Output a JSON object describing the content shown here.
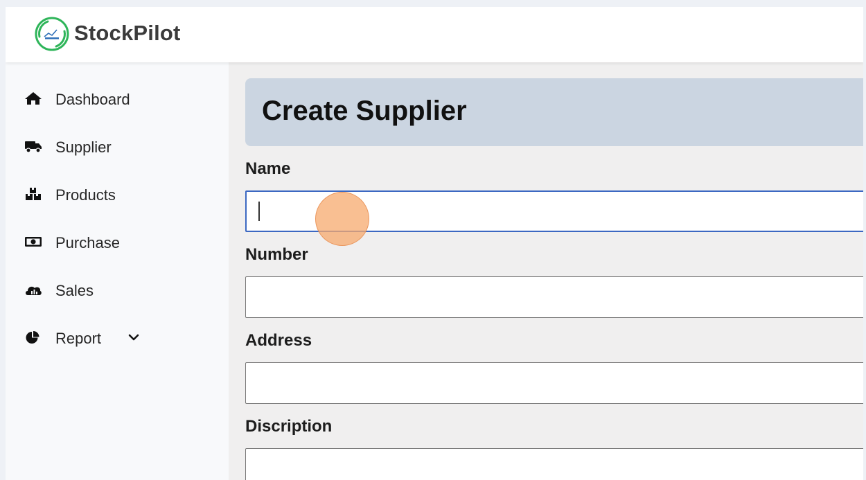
{
  "app": {
    "brand_name": "StockPilot",
    "accent_color": "#3c68c2",
    "header_bg": "#cbd5e1"
  },
  "sidebar": {
    "items": [
      {
        "label": "Dashboard",
        "icon": "home-icon"
      },
      {
        "label": "Supplier",
        "icon": "truck-icon"
      },
      {
        "label": "Products",
        "icon": "boxes-icon"
      },
      {
        "label": "Purchase",
        "icon": "money-bill-icon"
      },
      {
        "label": "Sales",
        "icon": "cloud-chart-icon"
      },
      {
        "label": "Report",
        "icon": "pie-chart-icon",
        "has_dropdown": true
      }
    ]
  },
  "page": {
    "title": "Create Supplier"
  },
  "form": {
    "fields": [
      {
        "label": "Name",
        "value": "",
        "focused": true
      },
      {
        "label": "Number",
        "value": ""
      },
      {
        "label": "Address",
        "value": ""
      },
      {
        "label": "Discription",
        "value": ""
      }
    ]
  }
}
